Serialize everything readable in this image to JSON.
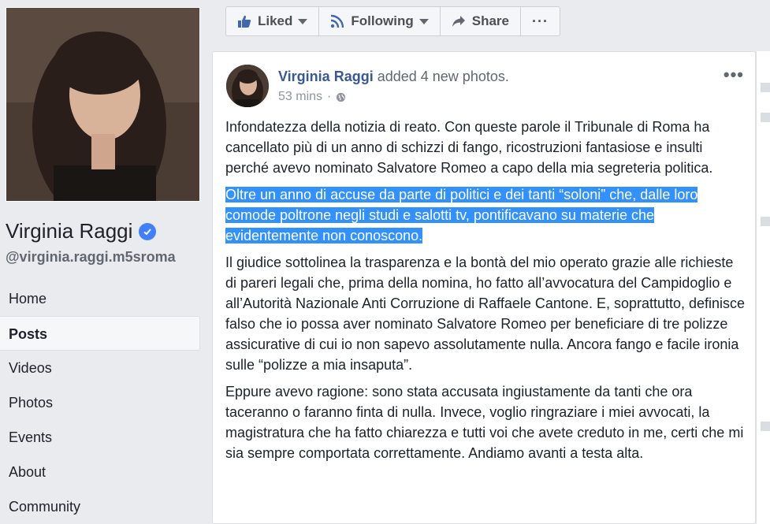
{
  "sidebar": {
    "page_name": "Virginia Raggi",
    "handle": "@virginia.raggi.m5sroma",
    "nav": [
      {
        "label": "Home"
      },
      {
        "label": "Posts"
      },
      {
        "label": "Videos"
      },
      {
        "label": "Photos"
      },
      {
        "label": "Events"
      },
      {
        "label": "About"
      },
      {
        "label": "Community"
      }
    ],
    "active_item": "Posts"
  },
  "actionbar": {
    "liked": "Liked",
    "following": "Following",
    "share": "Share",
    "more": "···"
  },
  "post": {
    "author": "Virginia Raggi",
    "action": "added 4 new photos.",
    "time": "53 mins",
    "separator": "·",
    "privacy_icon": "globe-icon",
    "more": "•••",
    "paragraphs": [
      "Infondatezza della notizia di reato. Con queste parole il Tribunale di Roma ha cancellato più di un anno di schizzi di fango, ricostruzioni fantasiose e insulti perché avevo nominato Salvatore Romeo a capo della mia segreteria politica.",
      "Oltre un anno di accuse da parte di politici e dei tanti “soloni” che, dalle loro comode poltrone negli studi e salotti tv, pontificavano su materie che evidentemente non conoscono.",
      "Il giudice sottolinea la trasparenza e la bontà del mio operato grazie alle richieste di pareri legali che, prima della nomina, ho fatto all’avvocatura del Campidoglio e all’Autorità Nazionale Anti Corruzione di Raffaele Cantone. E, soprattutto, definisce falso che io possa aver nominato Salvatore Romeo per beneficiare di tre polizze assicurative di cui io non sapevo assolutamente nulla. Ancora fango e facile ironia sulle “polizze a mia insaputa”.",
      "Eppure avevo ragione: sono stata accusata ingiustamente da tanti che ora taceranno o faranno finta di nulla. Invece, voglio ringraziare i miei avvocati, la magistratura che ha fatto chiarezza e tutti voi che avete creduto in me, certi che mi sia sempre comportata correttamente. Andiamo avanti a testa alta."
    ],
    "highlighted_paragraph": 1
  },
  "colors": {
    "link": "#385898",
    "selection": "#3390ff",
    "verified": "#4080ff",
    "background": "#e9ebee"
  }
}
